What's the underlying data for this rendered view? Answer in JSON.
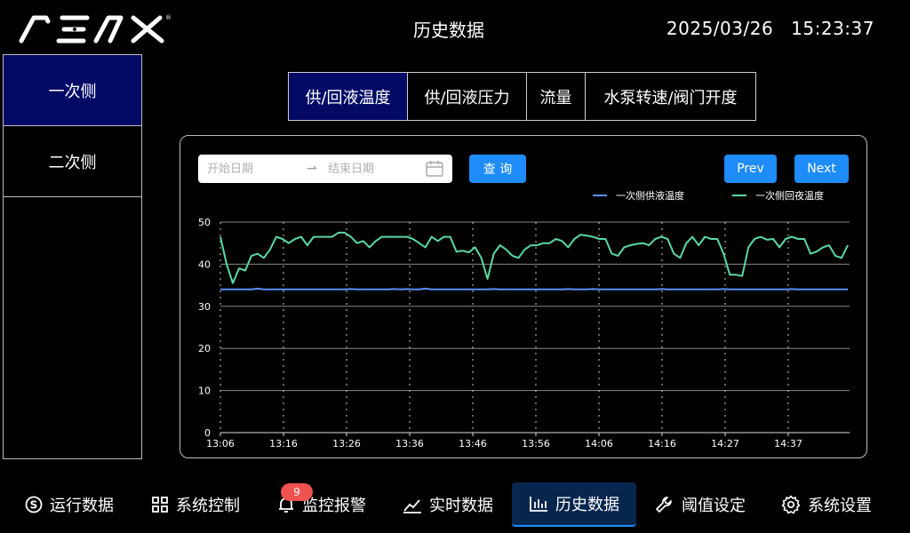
{
  "header": {
    "logo_text": "NENX",
    "title": "历史数据",
    "date": "2025/03/26",
    "time": "15:23:37"
  },
  "sidebar": {
    "items": [
      {
        "label": "一次侧",
        "active": true
      },
      {
        "label": "二次侧",
        "active": false
      }
    ]
  },
  "tabs": [
    {
      "label": "供/回液温度",
      "active": true
    },
    {
      "label": "供/回液压力",
      "active": false
    },
    {
      "label": "流量",
      "active": false
    },
    {
      "label": "水泵转速/阀门开度",
      "active": false
    }
  ],
  "filters": {
    "start_placeholder": "开始日期",
    "end_placeholder": "结束日期",
    "query_label": "查 询",
    "prev_label": "Prev",
    "next_label": "Next"
  },
  "colors": {
    "accent": "#1e8cfa",
    "active_bg": "#030a66",
    "supply": "#5b8ff9",
    "return": "#5ad8a6",
    "badge": "#f0524f"
  },
  "chart_data": {
    "type": "line",
    "ylim": [
      0,
      50
    ],
    "yticks": [
      0,
      10,
      20,
      30,
      40,
      50
    ],
    "tick_labels": [
      "13:06",
      "13:16",
      "13:26",
      "13:36",
      "13:46",
      "13:56",
      "14:06",
      "14:16",
      "14:27",
      "14:37"
    ],
    "grid": true,
    "legend_position": "top-right",
    "series": [
      {
        "name": "一次侧供液温度",
        "color": "#5b8ff9",
        "values": [
          34,
          34,
          34,
          34,
          34,
          34,
          34.2,
          34,
          34,
          34,
          34,
          34,
          34,
          34,
          34,
          34,
          34,
          34,
          34,
          34,
          34,
          34.1,
          34,
          34,
          34,
          34,
          34,
          34,
          34.1,
          34,
          34.1,
          34,
          34,
          34.2,
          34,
          34,
          34,
          34,
          34,
          34,
          34,
          34,
          34,
          34,
          34.1,
          34,
          34,
          34,
          34,
          34,
          34,
          34,
          34,
          34,
          34,
          34,
          34.1,
          34,
          34,
          34,
          34.1,
          34,
          34,
          34,
          34,
          34,
          34,
          34,
          34,
          34,
          34,
          34.1,
          34,
          34,
          34,
          34,
          34,
          34,
          34,
          34,
          34,
          34.1,
          34,
          34,
          34,
          34,
          34,
          34,
          34,
          34,
          34,
          34,
          34.1,
          34,
          34,
          34,
          34,
          34,
          34,
          34,
          34,
          34
        ]
      },
      {
        "name": "一次侧回夜温度",
        "color": "#5ad8a6",
        "values": [
          46.5,
          40,
          35.5,
          39,
          38.5,
          42,
          42.5,
          41.5,
          43.5,
          46.5,
          46,
          45,
          46,
          46.5,
          44.5,
          46.5,
          46.5,
          46.5,
          46.5,
          47.5,
          47.5,
          46.5,
          45,
          45.5,
          44,
          45.5,
          46.5,
          46.5,
          46.5,
          46.5,
          46.5,
          46,
          45,
          44,
          46.5,
          45.5,
          46.5,
          46.5,
          43,
          43.2,
          42.8,
          44,
          41.5,
          36.5,
          42.5,
          44.5,
          43.5,
          42,
          41.5,
          43.5,
          44.5,
          44.5,
          45,
          45,
          46,
          45.5,
          44,
          46,
          47,
          46.8,
          46.5,
          46,
          46,
          42.5,
          42,
          44,
          44.5,
          44.8,
          45,
          44.5,
          46,
          46.5,
          46,
          42.5,
          41.5,
          45,
          46.5,
          44.5,
          46.5,
          46,
          46,
          42.5,
          37.5,
          37.5,
          37.2,
          44,
          46,
          46.5,
          45.8,
          46,
          44,
          46,
          46.5,
          46,
          46,
          42.5,
          43,
          44,
          44.5,
          42,
          41.5,
          44.5
        ]
      }
    ]
  },
  "nav": [
    {
      "label": "运行数据",
      "icon": "skype-icon"
    },
    {
      "label": "系统控制",
      "icon": "grid-icon"
    },
    {
      "label": "监控报警",
      "icon": "bell-icon"
    },
    {
      "label": "实时数据",
      "icon": "line-chart-icon"
    },
    {
      "label": "历史数据",
      "icon": "bar-chart-icon",
      "active": true
    },
    {
      "label": "阈值设定",
      "icon": "wrench-icon"
    },
    {
      "label": "系统设置",
      "icon": "gear-icon"
    }
  ],
  "alarm_badge": "9"
}
